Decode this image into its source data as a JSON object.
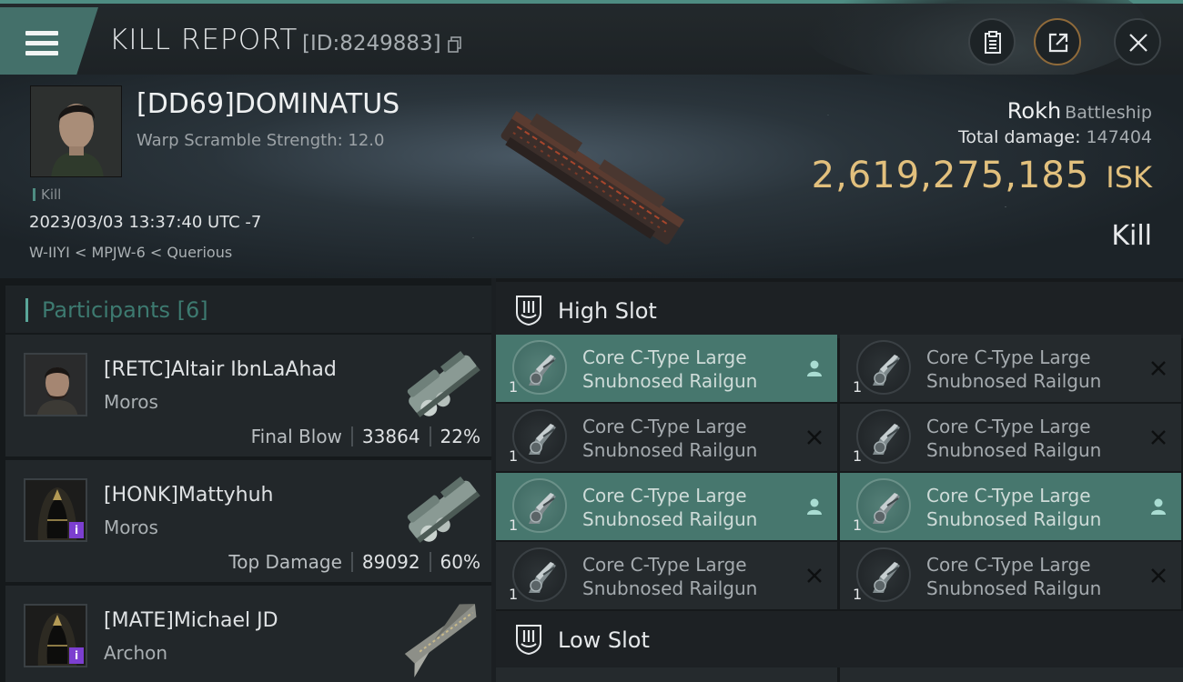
{
  "header": {
    "title": "KILL REPORT",
    "report_id": "[ID:8249883]",
    "icons": [
      "menu-icon",
      "copy-icon",
      "clipboard-icon",
      "share-icon",
      "close-icon"
    ]
  },
  "victim": {
    "name": "[DD69]DOMINATUS",
    "warp_scramble": "Warp Scramble Strength: 12.0",
    "tag": "Kill",
    "datetime": "2023/03/03 13:37:40 UTC -7",
    "location": "W-IIYI < MPJW-6 < Querious",
    "ship_name": "Rokh",
    "ship_class": "Battleship",
    "total_damage_label": "Total damage:",
    "total_damage": "147404",
    "isk_value": "2,619,275,185",
    "isk_unit": "ISK",
    "result": "Kill"
  },
  "participants": {
    "title": "Participants",
    "count": "[6]",
    "rows": [
      {
        "name": "[RETC]Altair IbnLaAhad",
        "ship": "Moros",
        "role": "Final Blow",
        "damage": "33864",
        "percent": "22%"
      },
      {
        "name": "[HONK]Mattyhuh",
        "ship": "Moros",
        "role": "Top Damage",
        "damage": "89092",
        "percent": "60%",
        "badge": "i"
      },
      {
        "name": "[MATE]Michael JD",
        "ship": "Archon",
        "badge": "i"
      }
    ]
  },
  "slots": {
    "high_slot_title": "High Slot",
    "low_slot_title": "Low Slot",
    "high_items": [
      {
        "qty": "1",
        "line1": "Core C-Type Large",
        "line2": "Snubnosed Railgun",
        "status": "fitted"
      },
      {
        "qty": "1",
        "line1": "Core C-Type Large",
        "line2": "Snubnosed Railgun",
        "status": "destroyed"
      },
      {
        "qty": "1",
        "line1": "Core C-Type Large",
        "line2": "Snubnosed Railgun",
        "status": "destroyed"
      },
      {
        "qty": "1",
        "line1": "Core C-Type Large",
        "line2": "Snubnosed Railgun",
        "status": "destroyed"
      },
      {
        "qty": "1",
        "line1": "Core C-Type Large",
        "line2": "Snubnosed Railgun",
        "status": "fitted"
      },
      {
        "qty": "1",
        "line1": "Core C-Type Large",
        "line2": "Snubnosed Railgun",
        "status": "fitted"
      },
      {
        "qty": "1",
        "line1": "Core C-Type Large",
        "line2": "Snubnosed Railgun",
        "status": "destroyed"
      },
      {
        "qty": "1",
        "line1": "Core C-Type Large",
        "line2": "Snubnosed Railgun",
        "status": "destroyed"
      }
    ]
  },
  "colors": {
    "accent": "#4e8c82",
    "isk": "#e2c07d",
    "fitted_bg": "#47776e",
    "badge": "#7c3fd0"
  }
}
